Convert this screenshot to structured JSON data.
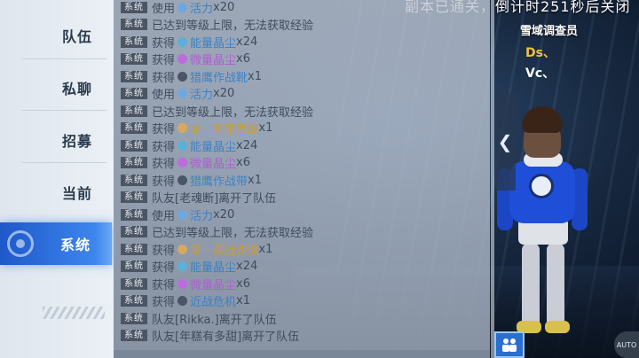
{
  "tabs": [
    {
      "label": "队伍",
      "active": false
    },
    {
      "label": "私聊",
      "active": false
    },
    {
      "label": "招募",
      "active": false
    },
    {
      "label": "当前",
      "active": false
    },
    {
      "label": "系统",
      "active": true
    }
  ],
  "chat": {
    "badge": "系统",
    "messages": [
      {
        "parts": [
          {
            "t": "使用 "
          },
          {
            "icon": "blue-crystal-icon",
            "color": "#6fa8e0"
          },
          {
            "t": "活力",
            "c": "blue"
          },
          {
            "t": "x20"
          }
        ]
      },
      {
        "parts": [
          {
            "t": "已达到等级上限，无法获取经验"
          }
        ]
      },
      {
        "parts": [
          {
            "t": "获得 "
          },
          {
            "icon": "blue-crystal-icon",
            "color": "#5ab0d8"
          },
          {
            "t": "能量晶尘",
            "c": "blue"
          },
          {
            "t": "x24"
          }
        ]
      },
      {
        "parts": [
          {
            "t": "获得 "
          },
          {
            "icon": "purple-crystal-icon",
            "color": "#c06ae0"
          },
          {
            "t": "微量晶尘",
            "c": "purple"
          },
          {
            "t": "x6"
          }
        ]
      },
      {
        "parts": [
          {
            "t": "获得 "
          },
          {
            "icon": "boots-icon",
            "color": "#4a5568"
          },
          {
            "t": "猎鹰作战靴",
            "c": "blue"
          },
          {
            "t": "x1"
          }
        ]
      },
      {
        "parts": [
          {
            "t": "使用 "
          },
          {
            "icon": "blue-crystal-icon",
            "color": "#6fa8e0"
          },
          {
            "t": "活力",
            "c": "blue"
          },
          {
            "t": "x20"
          }
        ]
      },
      {
        "parts": [
          {
            "t": "已达到等级上限，无法获取经验"
          }
        ]
      },
      {
        "parts": [
          {
            "t": "获得 "
          },
          {
            "icon": "avatar-icon",
            "color": "#d8a860"
          },
          {
            "t": "零 · 有序思维",
            "c": "gold"
          },
          {
            "t": "x1"
          }
        ]
      },
      {
        "parts": [
          {
            "t": "获得 "
          },
          {
            "icon": "blue-crystal-icon",
            "color": "#5ab0d8"
          },
          {
            "t": "能量晶尘",
            "c": "blue"
          },
          {
            "t": "x24"
          }
        ]
      },
      {
        "parts": [
          {
            "t": "获得 "
          },
          {
            "icon": "purple-crystal-icon",
            "color": "#c06ae0"
          },
          {
            "t": "微量晶尘",
            "c": "purple"
          },
          {
            "t": "x6"
          }
        ]
      },
      {
        "parts": [
          {
            "t": "获得 "
          },
          {
            "icon": "belt-icon",
            "color": "#4a5568"
          },
          {
            "t": "猎鹰作战带",
            "c": "blue"
          },
          {
            "t": "x1"
          }
        ]
      },
      {
        "parts": [
          {
            "t": "队友[老魂断]离开了队伍"
          }
        ]
      },
      {
        "parts": [
          {
            "t": "使用 "
          },
          {
            "icon": "blue-crystal-icon",
            "color": "#6fa8e0"
          },
          {
            "t": "活力",
            "c": "blue"
          },
          {
            "t": "x20"
          }
        ]
      },
      {
        "parts": [
          {
            "t": "已达到等级上限，无法获取经验"
          }
        ]
      },
      {
        "parts": [
          {
            "t": "获得 "
          },
          {
            "icon": "avatar-icon",
            "color": "#d8a860"
          },
          {
            "t": "零 · 再战沙漠",
            "c": "gold"
          },
          {
            "t": "x1"
          }
        ]
      },
      {
        "parts": [
          {
            "t": "获得 "
          },
          {
            "icon": "blue-crystal-icon",
            "color": "#5ab0d8"
          },
          {
            "t": "能量晶尘",
            "c": "blue"
          },
          {
            "t": "x24"
          }
        ]
      },
      {
        "parts": [
          {
            "t": "获得 "
          },
          {
            "icon": "purple-crystal-icon",
            "color": "#c06ae0"
          },
          {
            "t": "微量晶尘",
            "c": "purple"
          },
          {
            "t": "x6"
          }
        ]
      },
      {
        "parts": [
          {
            "t": "获得 "
          },
          {
            "icon": "chip-icon",
            "color": "#4a5568"
          },
          {
            "t": "近战危机",
            "c": "blue"
          },
          {
            "t": "x1"
          }
        ]
      },
      {
        "parts": [
          {
            "t": "队友[Rikka.]离开了队伍"
          }
        ]
      },
      {
        "parts": [
          {
            "t": "队友[年糕有多甜]离开了队伍"
          }
        ]
      }
    ]
  },
  "countdown": "副本已通关，倒计时251秒后关闭",
  "team": {
    "title": "雪域调查员",
    "members": [
      "Ds、",
      "Vc、"
    ]
  },
  "controls": {
    "collapse_glyph": "❮",
    "auto_label": "AUTO"
  },
  "colors": {
    "accent": "#2f73e0",
    "item_blue": "#3b82c8",
    "item_purple": "#b25bd6",
    "item_gold": "#d09a32"
  }
}
